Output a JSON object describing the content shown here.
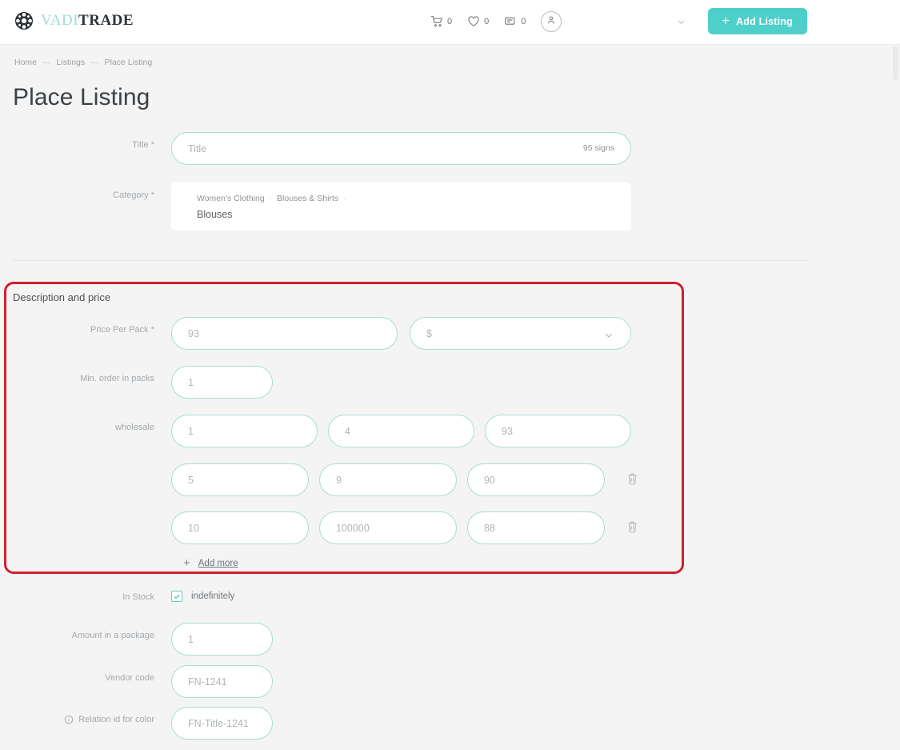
{
  "header": {
    "logo": {
      "part1": "VADI",
      "part2": "TRADE",
      "icon": "globe-grid-icon",
      "color_part1": "#9fdcd8"
    },
    "icons": [
      {
        "name": "cart-icon",
        "count": "0"
      },
      {
        "name": "heart-icon",
        "count": "0"
      },
      {
        "name": "message-icon",
        "count": "0"
      }
    ],
    "avatar_icon": "user-icon",
    "caret_icon": "chevron-down-icon",
    "add_listing_label": "Add Listing",
    "add_listing_plus": "+",
    "accent_color": "#4ecfc9"
  },
  "breadcrumb": {
    "items": [
      "Home",
      "Listings",
      "Place Listing"
    ],
    "separator": "—"
  },
  "page_title": "Place Listing",
  "form": {
    "title": {
      "label": "Title",
      "required": "*",
      "placeholder": "Title",
      "value": "",
      "counter": "95 signs"
    },
    "category": {
      "label": "Category",
      "required": "*",
      "path": [
        "Women's Clothing",
        "Blouses & Shirts"
      ],
      "separator": "·",
      "selected": "Blouses"
    }
  },
  "section": {
    "heading": "Description and price",
    "price_per_pack": {
      "label": "Price Per Pack",
      "required": "*",
      "placeholder": "93",
      "value": ""
    },
    "currency": {
      "placeholder": "$",
      "value": "",
      "caret_icon": "chevron-down-icon"
    },
    "min_order": {
      "label": "Min. order in packs",
      "placeholder": "1",
      "value": ""
    },
    "wholesale": {
      "label": "wholesale",
      "rows": [
        {
          "from": "1",
          "to": "4",
          "price": "93",
          "deletable": false
        },
        {
          "from": "5",
          "to": "9",
          "price": "90",
          "deletable": true
        },
        {
          "from": "10",
          "to": "100000",
          "price": "88",
          "deletable": true
        }
      ],
      "delete_icon": "trash-icon",
      "add_more_label": "Add more",
      "add_more_plus": "+"
    }
  },
  "stock": {
    "label": "In Stock",
    "checkbox_label": "indefinitely",
    "checked": true
  },
  "amount_in_package": {
    "label": "Amount in a package",
    "placeholder": "1",
    "value": ""
  },
  "vendor_code": {
    "label": "Vendor code",
    "placeholder": "FN-1241",
    "value": ""
  },
  "relation_id": {
    "label": "Relation id for color",
    "placeholder": "FN-Title-1241",
    "value": "",
    "info_icon": "info-icon"
  },
  "annotation": {
    "color": "#d0212a",
    "shape": "rounded-rectangle-highlight"
  }
}
